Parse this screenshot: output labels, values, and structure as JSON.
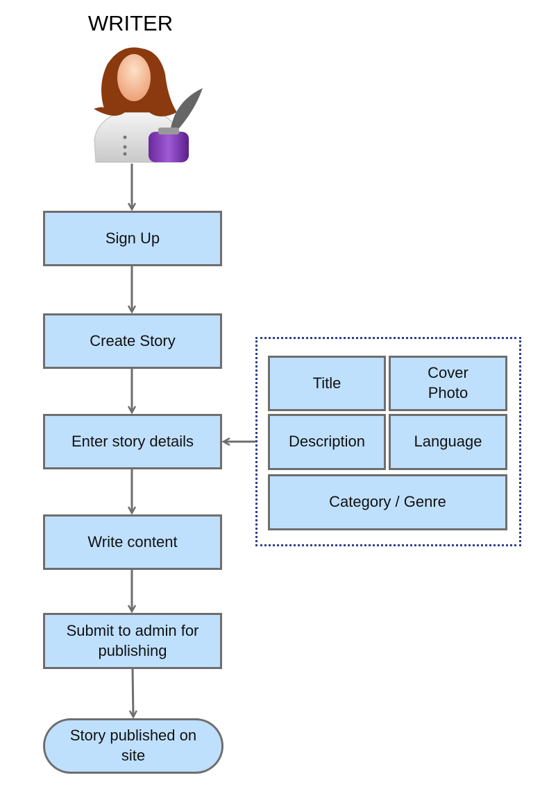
{
  "actor": {
    "label": "WRITER",
    "icon": "writer-avatar-with-quill-and-ink"
  },
  "steps": [
    {
      "label": "Sign Up"
    },
    {
      "label": "Create Story"
    },
    {
      "label": "Enter story details"
    },
    {
      "label": "Write content"
    },
    {
      "label": "Submit to admin for publishing"
    },
    {
      "label": "Story published on site"
    }
  ],
  "details": {
    "title": "Title",
    "cover_photo": "Cover Photo",
    "description": "Description",
    "language": "Language",
    "category": "Category / Genre"
  },
  "colors": {
    "box_fill": "#bfe0fd",
    "box_border": "#6e6e6e",
    "group_border": "#2d3f8c",
    "arrow": "#6e6e6e"
  }
}
